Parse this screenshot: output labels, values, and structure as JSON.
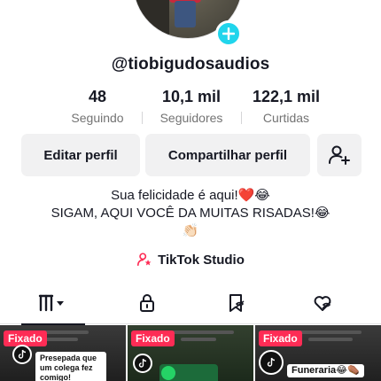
{
  "profile": {
    "username": "@tiobigudosaudios"
  },
  "stats": {
    "following": {
      "value": "48",
      "label": "Seguindo"
    },
    "followers": {
      "value": "10,1 mil",
      "label": "Seguidores"
    },
    "likes": {
      "value": "122,1 mil",
      "label": "Curtidas"
    }
  },
  "actions": {
    "edit_label": "Editar perfil",
    "share_label": "Compartilhar perfil"
  },
  "bio": {
    "line1": "Sua felicidade é aqui!❤️😂",
    "line2": "SIGAM, AQUI VOCÊ DA MUITAS RISADAS!😂",
    "line3": "👏🏻"
  },
  "studio": {
    "label": "TikTok Studio"
  },
  "videos": [
    {
      "pinned_label": "Fixado",
      "caption": "Presepada que um colega fez comigo!"
    },
    {
      "pinned_label": "Fixado"
    },
    {
      "pinned_label": "Fixado",
      "caption": "Funeraria😂⚰️"
    }
  ],
  "colors": {
    "accent_red": "#fe2c55",
    "badge_cyan": "#20d5ec",
    "button_bg": "#f1f1f2",
    "secondary_text": "#737373"
  }
}
